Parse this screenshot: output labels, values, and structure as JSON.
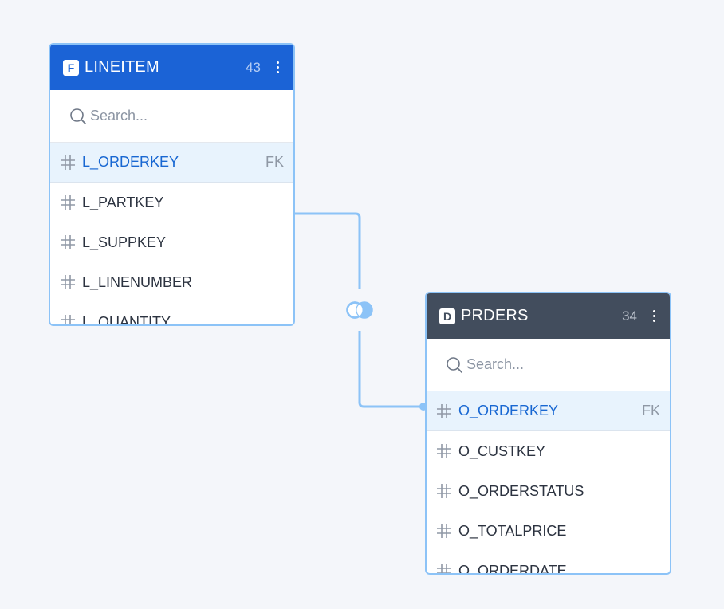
{
  "tables": [
    {
      "id": "lineitem",
      "type_badge": "F",
      "name": "LINEITEM",
      "column_count": "43",
      "search_placeholder": "Search...",
      "header_color": "#1b63d6",
      "fields": [
        {
          "name": "L_ORDERKEY",
          "key": "FK"
        },
        {
          "name": "L_PARTKEY",
          "key": ""
        },
        {
          "name": "L_SUPPKEY",
          "key": ""
        },
        {
          "name": "L_LINENUMBER",
          "key": ""
        },
        {
          "name": "L_QUANTITY",
          "key": ""
        }
      ]
    },
    {
      "id": "orders",
      "type_badge": "D",
      "name": "PRDERS",
      "column_count": "34",
      "search_placeholder": "Search...",
      "header_color": "#424d5d",
      "fields": [
        {
          "name": "O_ORDERKEY",
          "key": "FK"
        },
        {
          "name": "O_CUSTKEY",
          "key": ""
        },
        {
          "name": "O_ORDERSTATUS",
          "key": ""
        },
        {
          "name": "O_TOTALPRICE",
          "key": ""
        },
        {
          "name": "O_ORDERDATE",
          "key": ""
        }
      ]
    }
  ],
  "relationship": {
    "from": "L_ORDERKEY",
    "to": "O_ORDERKEY",
    "join_icon": "join-venn-icon",
    "line_color": "#8cc3f7"
  },
  "colors": {
    "background": "#f4f6fa",
    "card_border": "#8cc3f7",
    "key_row_bg": "#e8f3fd",
    "key_text": "#1867d2"
  }
}
